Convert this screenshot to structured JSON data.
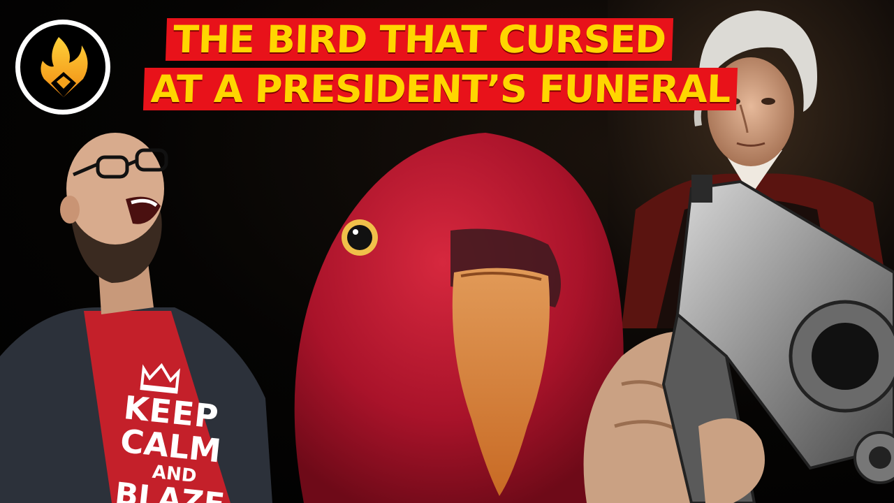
{
  "thumbnail": {
    "title_line_1": "THE BIRD THAT CURSED",
    "title_line_2": "AT A PRESIDENT’S FUNERAL",
    "shirt_lines": [
      "KEEP",
      "CALM",
      "AND",
      "BLAZE"
    ]
  },
  "logo": {
    "icon": "flame-logo-icon"
  },
  "colors": {
    "banner_red": "#e8121a",
    "title_yellow": "#ffd600",
    "parrot_red": "#b1162a",
    "beak_orange": "#d98a3a"
  }
}
